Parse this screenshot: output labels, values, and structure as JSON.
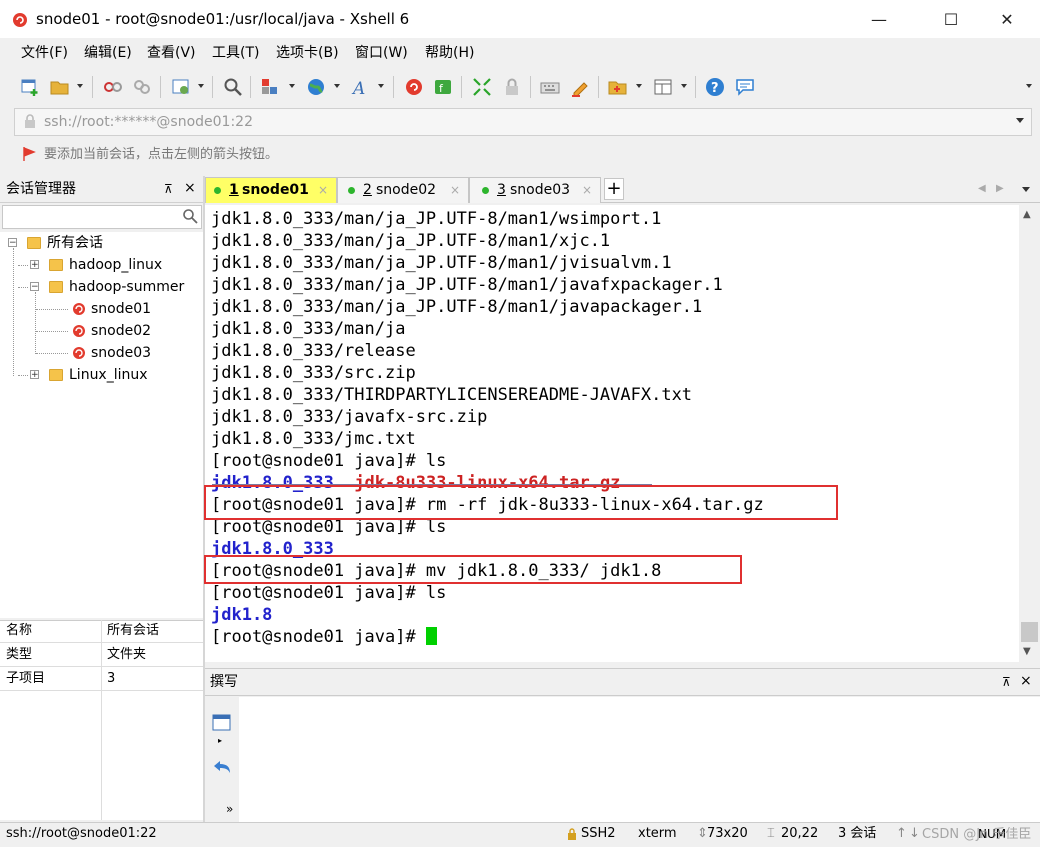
{
  "window": {
    "title": "snode01 - root@snode01:/usr/local/java - Xshell 6",
    "minimize": "—",
    "maximize": "☐",
    "close": "✕"
  },
  "menu": [
    "文件(F)",
    "编辑(E)",
    "查看(V)",
    "工具(T)",
    "选项卡(B)",
    "窗口(W)",
    "帮助(H)"
  ],
  "address": {
    "text": "ssh://root:******@snode01:22"
  },
  "hint": {
    "text": "要添加当前会话，点击左侧的箭头按钮。"
  },
  "session_panel": {
    "title": "会话管理器",
    "pin": "⊼",
    "close": "×",
    "tree": {
      "root": "所有会话",
      "folders": [
        "hadoop_linux",
        "hadoop-summer",
        "Linux_linux"
      ],
      "sessions": [
        "snode01",
        "snode02",
        "snode03"
      ]
    },
    "properties": [
      {
        "key": "名称",
        "value": "所有会话"
      },
      {
        "key": "类型",
        "value": "文件夹"
      },
      {
        "key": "子项目",
        "value": "3"
      }
    ]
  },
  "tabs": [
    {
      "num": "1",
      "label": "snode01",
      "active": true
    },
    {
      "num": "2",
      "label": "snode02",
      "active": false
    },
    {
      "num": "3",
      "label": "snode03",
      "active": false
    }
  ],
  "terminal": {
    "lines": [
      "jdk1.8.0_333/man/ja_JP.UTF-8/man1/wsimport.1",
      "jdk1.8.0_333/man/ja_JP.UTF-8/man1/xjc.1",
      "jdk1.8.0_333/man/ja_JP.UTF-8/man1/jvisualvm.1",
      "jdk1.8.0_333/man/ja_JP.UTF-8/man1/javafxpackager.1",
      "jdk1.8.0_333/man/ja_JP.UTF-8/man1/javapackager.1",
      "jdk1.8.0_333/man/ja",
      "jdk1.8.0_333/release",
      "jdk1.8.0_333/src.zip",
      "jdk1.8.0_333/THIRDPARTYLICENSEREADME-JAVAFX.txt",
      "jdk1.8.0_333/javafx-src.zip",
      "jdk1.8.0_333/jmc.txt",
      "[root@snode01 java]# ls"
    ],
    "ls1_dir": "jdk1.8.0_333",
    "ls1_gap": "  ",
    "ls1_archive": "jdk-8u333-linux-x64.tar.gz",
    "cmd_rm": "[root@snode01 java]# rm -rf jdk-8u333-linux-x64.tar.gz",
    "cmd_ls2": "[root@snode01 java]# ls",
    "ls2_dir": "jdk1.8.0_333",
    "cmd_mv": "[root@snode01 java]# mv jdk1.8.0_333/ jdk1.8",
    "cmd_ls3": "[root@snode01 java]# ls",
    "ls3_dir": "jdk1.8",
    "prompt": "[root@snode01 java]# "
  },
  "compose": {
    "title": "撰写",
    "pin": "⊼",
    "close": "×"
  },
  "statusbar": {
    "connection": "ssh://root@snode01:22",
    "protocol": "SSH2",
    "terminal": "xterm",
    "size": "73x20",
    "position": "20,22",
    "sessions": "3 会话",
    "caps": "CAP",
    "num": "NUM"
  },
  "watermark": "CSDN @Jn 乐佳臣",
  "colors": {
    "cursor": "#00d000",
    "directory": "#2222cc",
    "archive": "#cc2222",
    "highlight_box": "#e03030",
    "tab_active": "#ffff66",
    "tab_status_dot": "#2db52d"
  }
}
